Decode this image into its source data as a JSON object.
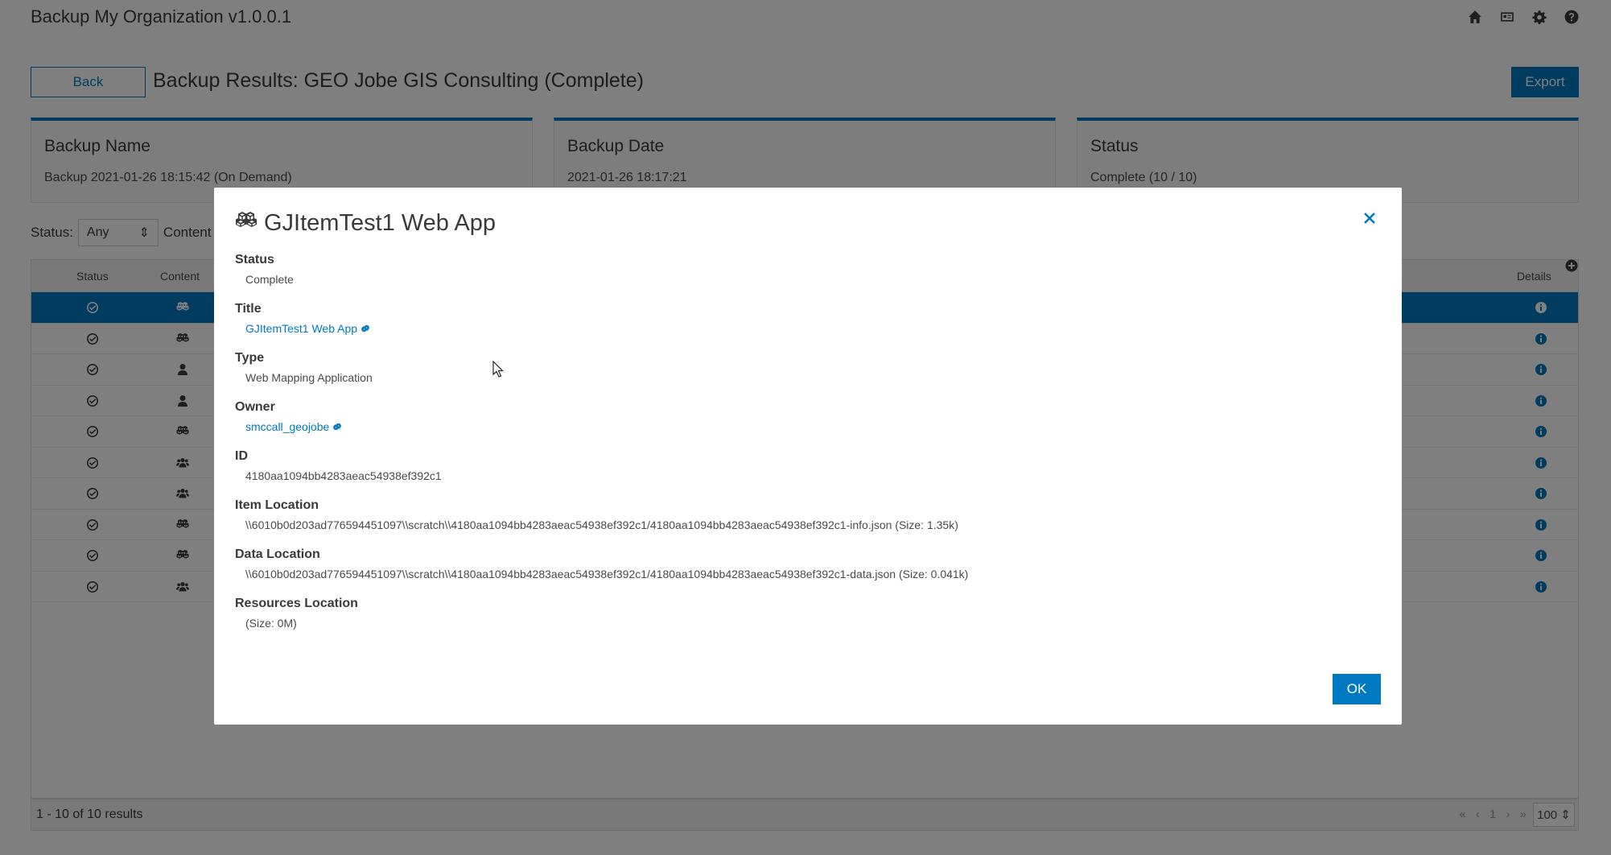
{
  "app": {
    "title": "Backup My Organization v1.0.0.1",
    "top_icons": [
      "home-icon",
      "id-card-icon",
      "gear-icon",
      "help-icon"
    ]
  },
  "header": {
    "back_label": "Back",
    "page_title": "Backup Results: GEO Jobe GIS Consulting (Complete)",
    "export_label": "Export"
  },
  "summary": {
    "cards": [
      {
        "title": "Backup Name",
        "value": "Backup 2021-01-26 18:15:42 (On Demand)"
      },
      {
        "title": "Backup Date",
        "value": "2021-01-26 18:17:21"
      },
      {
        "title": "Status",
        "value": "Complete (10 / 10)"
      }
    ]
  },
  "filters": {
    "status_label": "Status:",
    "status_value": "Any",
    "content_label": "Content"
  },
  "table": {
    "columns": [
      "Status",
      "Content",
      "Details"
    ],
    "rows": [
      {
        "status_icon": "check-circle-icon",
        "content_icon": "cubes-icon",
        "selected": true
      },
      {
        "status_icon": "check-circle-icon",
        "content_icon": "cubes-icon",
        "selected": false
      },
      {
        "status_icon": "check-circle-icon",
        "content_icon": "user-icon",
        "selected": false
      },
      {
        "status_icon": "check-circle-icon",
        "content_icon": "user-icon",
        "selected": false
      },
      {
        "status_icon": "check-circle-icon",
        "content_icon": "cubes-icon",
        "selected": false
      },
      {
        "status_icon": "check-circle-icon",
        "content_icon": "users-icon",
        "selected": false
      },
      {
        "status_icon": "check-circle-icon",
        "content_icon": "users-icon",
        "selected": false
      },
      {
        "status_icon": "check-circle-icon",
        "content_icon": "cubes-icon",
        "selected": false
      },
      {
        "status_icon": "check-circle-icon",
        "content_icon": "cubes-icon",
        "selected": false
      },
      {
        "status_icon": "check-circle-icon",
        "content_icon": "users-icon",
        "selected": false
      }
    ],
    "footer": {
      "results": "1 - 10 of 10 results",
      "pager": "« ‹ 1 › »",
      "page_size": "100"
    }
  },
  "modal": {
    "title": "GJItemTest1 Web App",
    "icon": "cubes-icon",
    "fields": [
      {
        "label": "Status",
        "value": "Complete",
        "link": false
      },
      {
        "label": "Title",
        "value": "GJItemTest1 Web App",
        "link": true
      },
      {
        "label": "Type",
        "value": "Web Mapping Application",
        "link": false
      },
      {
        "label": "Owner",
        "value": "smccall_geojobe",
        "link": true
      },
      {
        "label": "ID",
        "value": "4180aa1094bb4283aeac54938ef392c1",
        "link": false
      },
      {
        "label": "Item Location",
        "value": "\\\\6010b0d203ad776594451097\\\\scratch\\\\4180aa1094bb4283aeac54938ef392c1/4180aa1094bb4283aeac54938ef392c1-info.json (Size: 1.35k)",
        "link": false
      },
      {
        "label": "Data Location",
        "value": "\\\\6010b0d203ad776594451097\\\\scratch\\\\4180aa1094bb4283aeac54938ef392c1/4180aa1094bb4283aeac54938ef392c1-data.json (Size: 0.041k)",
        "link": false
      },
      {
        "label": "Resources Location",
        "value": "(Size: 0M)",
        "link": false
      }
    ],
    "ok_label": "OK"
  },
  "colors": {
    "accent": "#0079c1",
    "overlay": "rgba(0,0,0,0.5)"
  }
}
